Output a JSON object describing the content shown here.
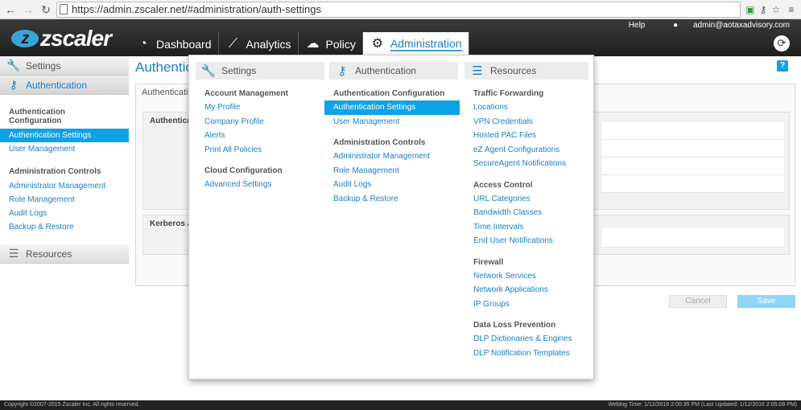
{
  "browser": {
    "url": "https://admin.zscaler.net/#administration/auth-settings"
  },
  "header": {
    "brand": "zscaler",
    "help": "Help",
    "user": "admin@aotaxadvisory.com",
    "tabs": [
      {
        "label": "Dashboard"
      },
      {
        "label": "Analytics"
      },
      {
        "label": "Policy"
      },
      {
        "label": "Administration"
      }
    ]
  },
  "sidebar": {
    "settings": "Settings",
    "authentication": "Authentication",
    "resources": "Resources",
    "groups": [
      {
        "title": "Authentication Configuration",
        "items": [
          "Authentication Settings",
          "User Management"
        ]
      },
      {
        "title": "Administration Controls",
        "items": [
          "Administrator Management",
          "Role Management",
          "Audit Logs",
          "Backup & Restore"
        ]
      }
    ]
  },
  "content": {
    "title": "Authentic",
    "tab": "Authenticatio",
    "panel1": "Authenticat",
    "panel2": "Kerberos Au",
    "cancel": "Cancel",
    "save": "Save"
  },
  "dropdown": {
    "columns": [
      {
        "heading": "Settings",
        "groups": [
          {
            "title": "Account Management",
            "items": [
              "My Profile",
              "Company Profile",
              "Alerts",
              "Print All Policies"
            ]
          },
          {
            "title": "Cloud Configuration",
            "items": [
              "Advanced Settings"
            ]
          }
        ]
      },
      {
        "heading": "Authentication",
        "groups": [
          {
            "title": "Authentication Configuration",
            "items": [
              "Authentication Settings",
              "User Management"
            ]
          },
          {
            "title": "Administration Controls",
            "items": [
              "Administrator Management",
              "Role Management",
              "Audit Logs",
              "Backup & Restore"
            ]
          }
        ]
      },
      {
        "heading": "Resources",
        "groups": [
          {
            "title": "Traffic Forwarding",
            "items": [
              "Locations",
              "VPN Credentials",
              "Hosted PAC Files",
              "eZ Agent Configurations",
              "SecureAgent Notifications"
            ]
          },
          {
            "title": "Access Control",
            "items": [
              "URL Categories",
              "Bandwidth Classes",
              "Time Intervals",
              "End User Notifications"
            ]
          },
          {
            "title": "Firewall",
            "items": [
              "Network Services",
              "Network Applications",
              "IP Groups"
            ]
          },
          {
            "title": "Data Loss Prevention",
            "items": [
              "DLP Dictionaries & Engines",
              "DLP Notification Templates"
            ]
          }
        ]
      }
    ]
  },
  "footer": {
    "copyright": "Copyright ©2007-2015 Zscaler Inc. All rights reserved.",
    "status": "Weblog Time: 1/12/2016 2:00:35 PM (Last Updated: 1/12/2016 2:05:08 PM)"
  },
  "colors": {
    "accent": "#0fa3e6",
    "link": "#1a7fc1",
    "header": "#2a2a2a"
  }
}
